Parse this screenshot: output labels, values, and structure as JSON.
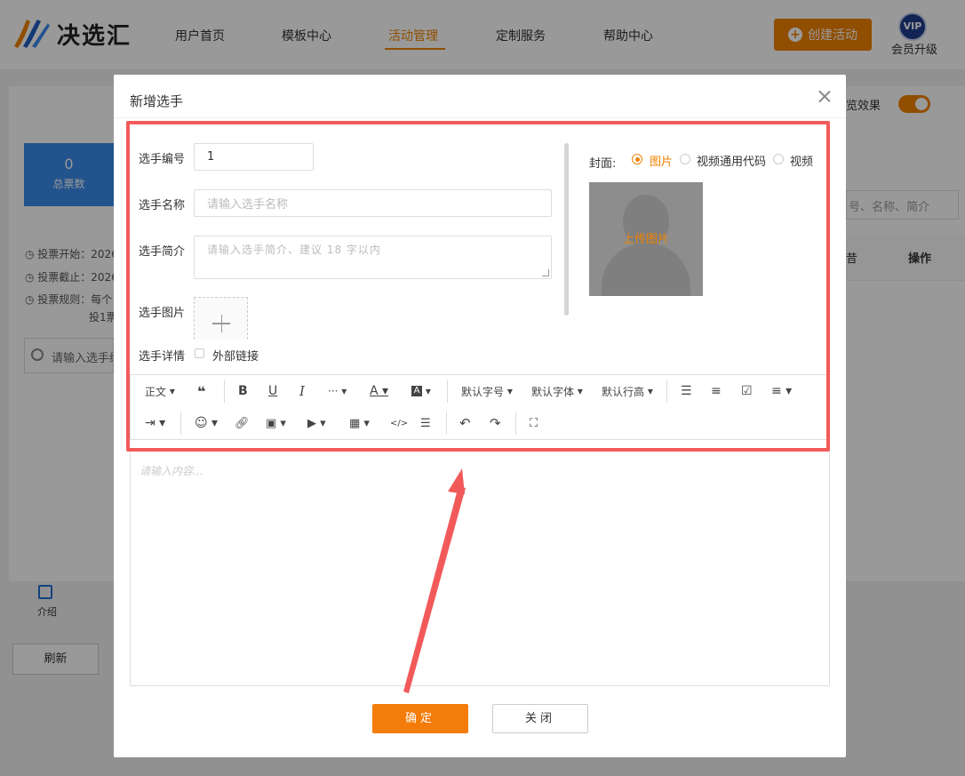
{
  "brand": {
    "name": "决选汇"
  },
  "nav": {
    "items": [
      {
        "label": "用户首页"
      },
      {
        "label": "模板中心"
      },
      {
        "label": "活动管理",
        "active": true
      },
      {
        "label": "定制服务"
      },
      {
        "label": "帮助中心"
      }
    ]
  },
  "header": {
    "create_label": "创建活动",
    "vip_badge": "VIP",
    "vip_label": "会员升级"
  },
  "background": {
    "stat_value": "0",
    "stat_label": "总票数",
    "info_lines": [
      "投票开始：2026-",
      "投票截止：2026-",
      "投票规则：每个",
      "投1票"
    ],
    "search_placeholder": "请输入选手编",
    "intro_label": "介绍",
    "refresh_label": "刷新",
    "preview_label": "览效果",
    "right_search": "号、名称、简介",
    "op_label": "操作",
    "op_partial": "昔"
  },
  "modal": {
    "title": "新增选手",
    "fields": {
      "number_label": "选手编号",
      "number_value": "1",
      "name_label": "选手名称",
      "name_placeholder": "请输入选手名称",
      "intro_label": "选手简介",
      "intro_placeholder": "请输入选手简介、建议 18 字以内",
      "image_label": "选手图片",
      "detail_label": "选手详情",
      "external_link_label": "外部链接"
    },
    "cover": {
      "label": "封面:",
      "options": [
        "图片",
        "视频通用代码",
        "视频"
      ],
      "selected": "图片",
      "upload_label": "上传图片"
    },
    "toolbar": {
      "paragraph": "正文",
      "font_size": "默认字号",
      "font_family": "默认字体",
      "line_height": "默认行高"
    },
    "editor_placeholder": "请输入内容...",
    "confirm_label": "确定",
    "close_label": "关闭"
  },
  "colors": {
    "accent": "#f08200",
    "highlight": "#f25a5a",
    "stat_blue": "#3b8beb"
  }
}
